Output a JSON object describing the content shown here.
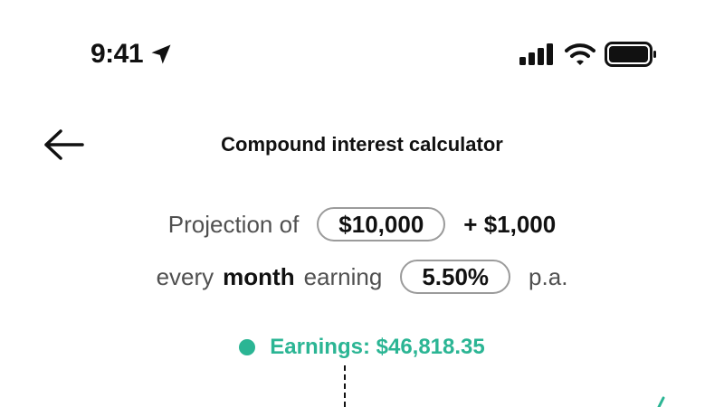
{
  "status_bar": {
    "time": "9:41",
    "location_icon": "location-arrow-icon",
    "signal_icon": "cellular-signal-icon",
    "wifi_icon": "wifi-icon",
    "battery_icon": "battery-icon"
  },
  "header": {
    "back_icon": "arrow-left-icon",
    "title": "Compound interest calculator"
  },
  "projection": {
    "prefix": "Projection of",
    "initial_amount": "$10,000",
    "contribution": "+ $1,000",
    "every_label": "every",
    "frequency": "month",
    "earning_label": "earning",
    "rate": "5.50%",
    "suffix": "p.a."
  },
  "earnings": {
    "label": "Earnings: $46,818.35"
  },
  "colors": {
    "accent": "#2bb594",
    "text": "#111111",
    "muted_text": "#505050",
    "pill_border": "#9b9b9b"
  }
}
